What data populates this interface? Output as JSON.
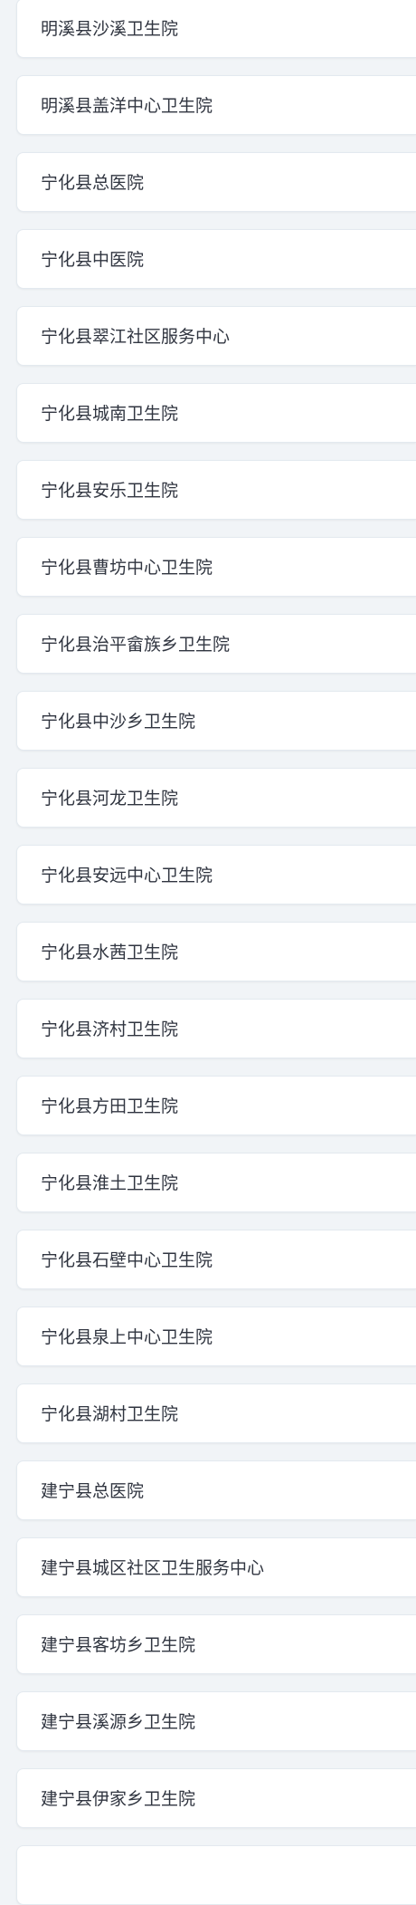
{
  "hospital_list": {
    "items": [
      "明溪县沙溪卫生院",
      "明溪县盖洋中心卫生院",
      "宁化县总医院",
      "宁化县中医院",
      "宁化县翠江社区服务中心",
      "宁化县城南卫生院",
      "宁化县安乐卫生院",
      "宁化县曹坊中心卫生院",
      "宁化县治平畲族乡卫生院",
      "宁化县中沙乡卫生院",
      "宁化县河龙卫生院",
      "宁化县安远中心卫生院",
      "宁化县水茜卫生院",
      "宁化县济村卫生院",
      "宁化县方田卫生院",
      "宁化县淮土卫生院",
      "宁化县石壁中心卫生院",
      "宁化县泉上中心卫生院",
      "宁化县湖村卫生院",
      "建宁县总医院",
      "建宁县城区社区卫生服务中心",
      "建宁县客坊乡卫生院",
      "建宁县溪源乡卫生院",
      "建宁县伊家乡卫生院",
      ""
    ]
  }
}
